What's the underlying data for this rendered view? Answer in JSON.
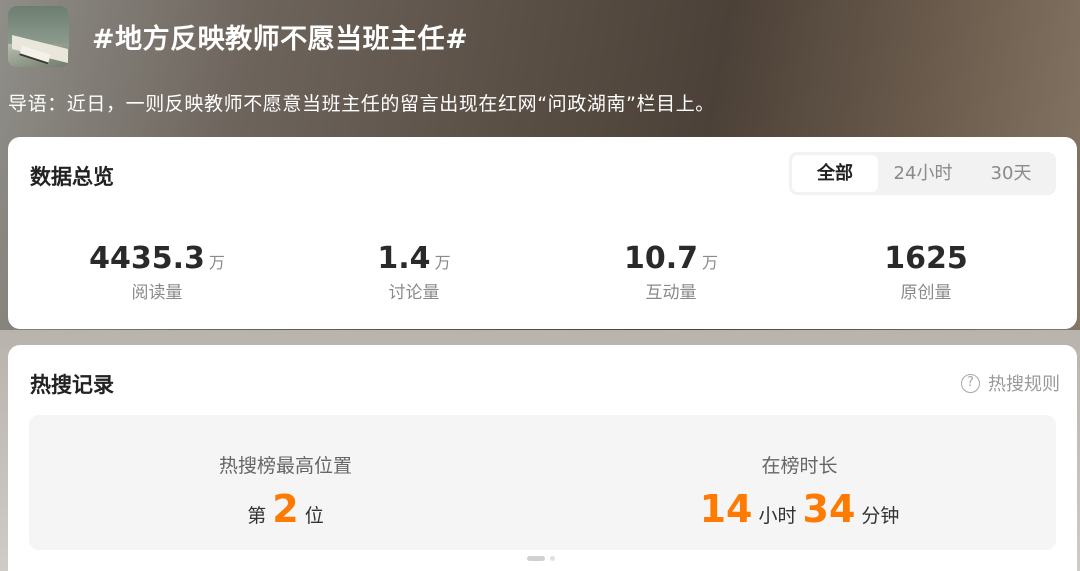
{
  "topic": {
    "title": "#地方反映教师不愿当班主任#",
    "lead": "导语：近日，一则反映教师不愿意当班主任的留言出现在红网“问政湖南”栏目上。"
  },
  "overview": {
    "title": "数据总览",
    "tabs": [
      {
        "label": "全部",
        "active": true
      },
      {
        "label": "24小时",
        "active": false
      },
      {
        "label": "30天",
        "active": false
      }
    ],
    "stats": [
      {
        "value": "4435.3",
        "unit": "万",
        "label": "阅读量"
      },
      {
        "value": "1.4",
        "unit": "万",
        "label": "讨论量"
      },
      {
        "value": "10.7",
        "unit": "万",
        "label": "互动量"
      },
      {
        "value": "1625",
        "unit": "",
        "label": "原创量"
      }
    ]
  },
  "hot_search": {
    "title": "热搜记录",
    "rules_label": "热搜规则",
    "rules_icon": "help-icon",
    "peak": {
      "label": "热搜榜最高位置",
      "prefix": "第",
      "value": "2",
      "suffix": "位"
    },
    "duration": {
      "label": "在榜时长",
      "hours": "14",
      "hours_unit": "小时",
      "minutes": "34",
      "minutes_unit": "分钟"
    },
    "accent_color": "#ff7a00"
  }
}
